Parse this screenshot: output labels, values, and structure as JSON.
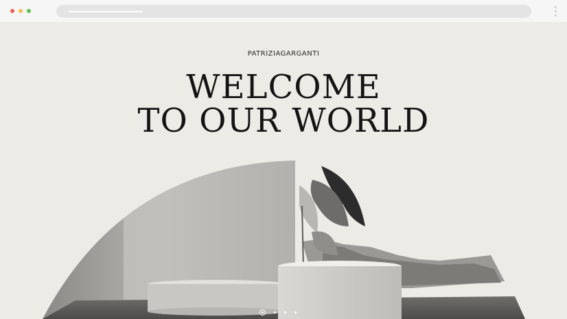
{
  "brand": {
    "name": "PATRIZIAGARGANTI"
  },
  "hero": {
    "line1": "WELCOME",
    "line2": "TO OUR WORLD"
  },
  "carousel": {
    "total": 4,
    "active": 1
  },
  "colors": {
    "background": "#edebe6",
    "text": "#141414",
    "chrome": "#f6f6f6"
  }
}
